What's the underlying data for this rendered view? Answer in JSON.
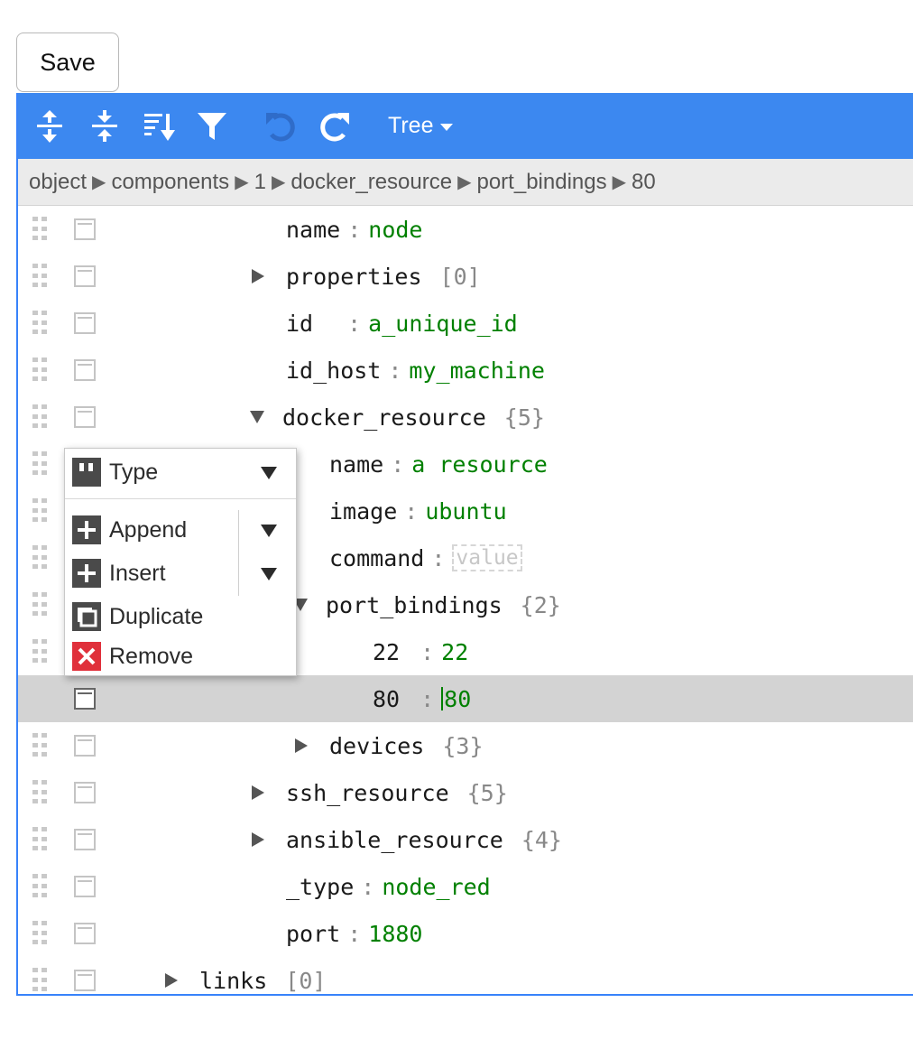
{
  "save_label": "Save",
  "toolbar": {
    "buttons": [
      "expand-all-icon",
      "collapse-all-icon",
      "sort-icon",
      "filter-icon",
      "undo-icon",
      "redo-icon"
    ],
    "mode_label": "Tree"
  },
  "breadcrumb": [
    "object",
    "components",
    "1",
    "docker_resource",
    "port_bindings",
    "80"
  ],
  "separator": ":",
  "tree": [
    {
      "key": "name",
      "value": "node",
      "type": "string"
    },
    {
      "key": "properties",
      "count": "[0]",
      "expander": "closed"
    },
    {
      "key": "id",
      "value": "a_unique_id",
      "type": "string"
    },
    {
      "key": "id_host",
      "value": "my_machine",
      "type": "string"
    },
    {
      "key": "docker_resource",
      "count": "{5}",
      "expander": "open"
    },
    {
      "key": "name",
      "value": "a resource",
      "type": "string"
    },
    {
      "key": "image",
      "value": "ubuntu",
      "type": "string"
    },
    {
      "key": "command",
      "placeholder": "value",
      "type": "empty"
    },
    {
      "key": "port_bindings",
      "count": "{2}",
      "expander": "open"
    },
    {
      "key": "22",
      "value": "22",
      "type": "number"
    },
    {
      "key": "80",
      "value": "80",
      "type": "number",
      "selected": true
    },
    {
      "key": "devices",
      "count": "{3}",
      "expander": "closed"
    },
    {
      "key": "ssh_resource",
      "count": "{5}",
      "expander": "closed"
    },
    {
      "key": "ansible_resource",
      "count": "{4}",
      "expander": "closed"
    },
    {
      "key": "_type",
      "value": "node_red",
      "type": "string"
    },
    {
      "key": "port",
      "value": "1880",
      "type": "number"
    },
    {
      "key": "links",
      "count": "[0]",
      "expander": "closed"
    }
  ],
  "context_menu": {
    "type_label": "Type",
    "append_label": "Append",
    "insert_label": "Insert",
    "duplicate_label": "Duplicate",
    "remove_label": "Remove"
  },
  "colors": {
    "menubar": "#3c88f0",
    "border": "#3883fa",
    "value_green": "#008000",
    "remove_red": "#e0303b",
    "selected_row": "#d3d3d3"
  }
}
